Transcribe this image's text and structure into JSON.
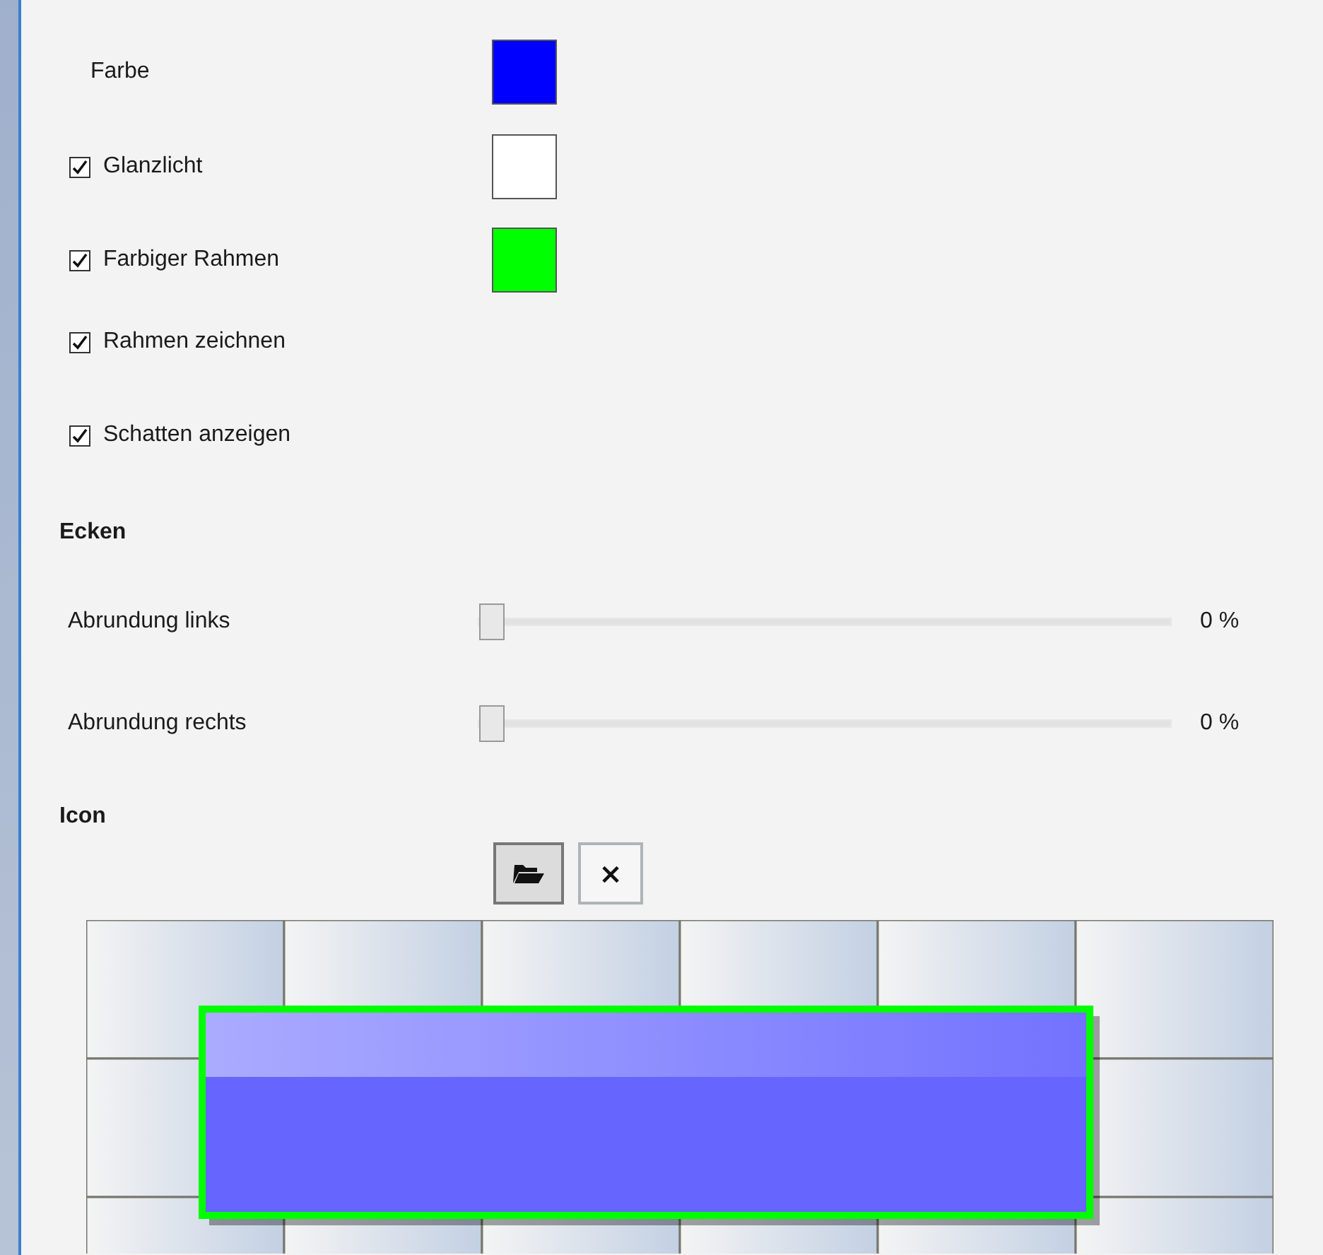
{
  "settings": [
    {
      "kind": "color",
      "label": "Farbe",
      "color": "#0000ff"
    },
    {
      "kind": "checkbox_color",
      "label": "Glanzlicht",
      "checked": true,
      "color": "#ffffff"
    },
    {
      "kind": "checkbox_color",
      "label": "Farbiger Rahmen",
      "checked": true,
      "color": "#00ff00"
    },
    {
      "kind": "checkbox",
      "label": "Rahmen zeichnen",
      "checked": true
    },
    {
      "kind": "checkbox",
      "label": "Schatten anzeigen",
      "checked": true
    }
  ],
  "corners": {
    "heading": "Ecken",
    "sliders": [
      {
        "label": "Abrundung links",
        "level": 0,
        "reading": "0 %"
      },
      {
        "label": "Abrundung rechts",
        "level": 0,
        "reading": "0 %"
      }
    ]
  },
  "icon": {
    "heading": "Icon",
    "buttons": [
      {
        "kind": "open",
        "pressed": true
      },
      {
        "kind": "clear",
        "pressed": false,
        "text": "×"
      }
    ]
  }
}
